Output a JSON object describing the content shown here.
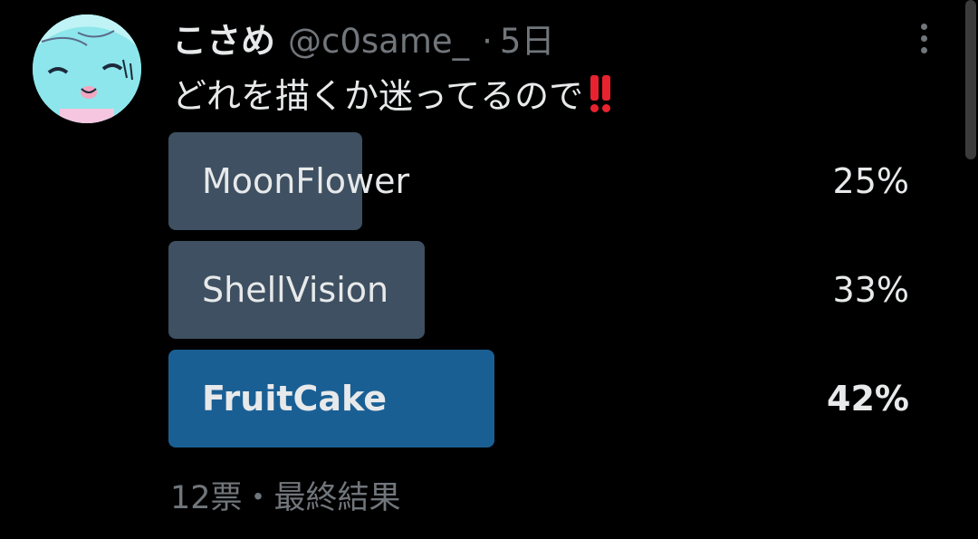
{
  "tweet": {
    "display_name": "こさめ",
    "handle": "@c0same_",
    "separator": "·",
    "time": "5日",
    "text": "どれを描くか迷ってるので",
    "emoji": "double-exclamation-emoji"
  },
  "poll": {
    "options": [
      {
        "label": "MoonFlower",
        "percent_text": "25%",
        "percent": 25,
        "winner": false
      },
      {
        "label": "ShellVision",
        "percent_text": "33%",
        "percent": 33,
        "winner": false
      },
      {
        "label": "FruitCake",
        "percent_text": "42%",
        "percent": 42,
        "winner": true
      }
    ],
    "footer": "12票・最終結果"
  },
  "icons": {
    "more": "more-vertical-icon",
    "avatar": "avatar-image"
  },
  "colors": {
    "background": "#000000",
    "text_primary": "#e7e9ea",
    "text_secondary": "#71767b",
    "bar_default": "#3e5061",
    "bar_winner": "#1a5f94",
    "emoji_red": "#e8232f"
  }
}
